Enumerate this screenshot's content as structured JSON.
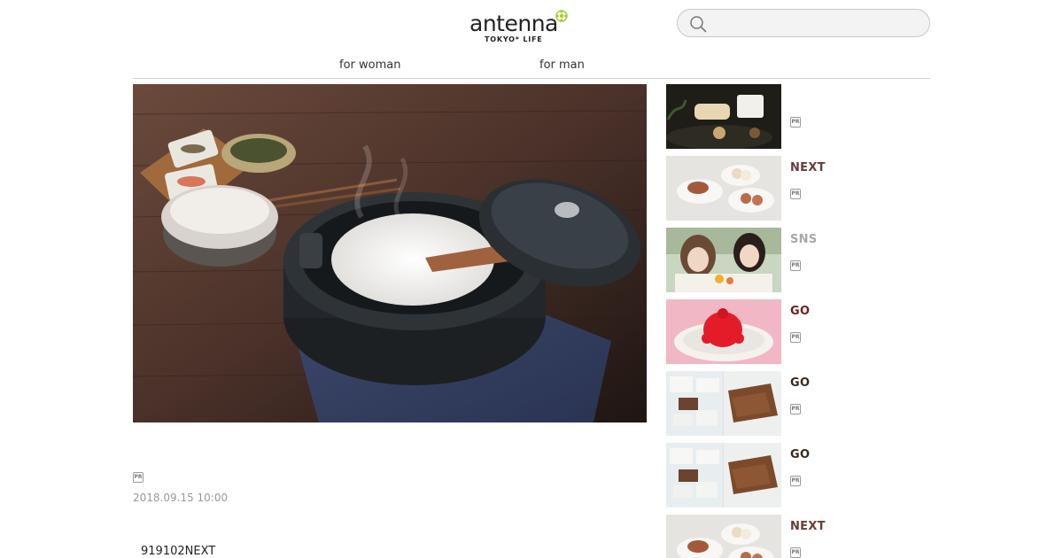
{
  "header": {
    "logo_text": "antenna",
    "logo_sub": "TOKYO* LIFE",
    "search": {
      "placeholder": "",
      "value": ""
    }
  },
  "nav": {
    "items": [
      {
        "label": "for woman"
      },
      {
        "label": "for man"
      }
    ]
  },
  "article": {
    "pr_label": "PR",
    "date": "2018.09.15 10:00",
    "body_text": "919102NEXT"
  },
  "sidebar": {
    "items": [
      {
        "category": "",
        "category_color": "#6b3b3b",
        "pr_label": "PR"
      },
      {
        "category": "NEXT",
        "category_color": "#6b3b3b",
        "pr_label": "PR"
      },
      {
        "category": "SNS",
        "category_color": "#a8a8a8",
        "pr_label": "PR"
      },
      {
        "category": "GO",
        "category_color": "#6e1d1d",
        "pr_label": "PR"
      },
      {
        "category": "GO",
        "category_color": "#3a2a1e",
        "pr_label": "PR"
      },
      {
        "category": "GO",
        "category_color": "#3a2a1e",
        "pr_label": "PR"
      },
      {
        "category": "NEXT",
        "category_color": "#6b3b3b",
        "pr_label": "PR"
      }
    ]
  },
  "colors": {
    "accent_green": "#a6cc2b",
    "border": "#cfcfcf"
  }
}
